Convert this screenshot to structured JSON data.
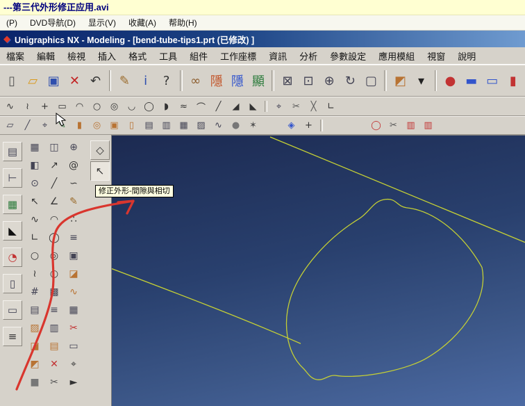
{
  "player": {
    "title": "---第三代外形修正应用.avi",
    "menus": [
      "(P)",
      "DVD导航(D)",
      "显示(V)",
      "收藏(A)",
      "帮助(H)"
    ]
  },
  "nx": {
    "title": "Unigraphics NX - Modeling - [bend-tube-tips1.prt (已修改) ]",
    "menus": [
      "檔案",
      "編輯",
      "檢視",
      "插入",
      "格式",
      "工具",
      "組件",
      "工作座標",
      "資訊",
      "分析",
      "參數設定",
      "應用模組",
      "視窗",
      "說明"
    ]
  },
  "tooltip": {
    "text": "修正外形-間隙與相切"
  },
  "colors": {
    "curve": "#c4cf35",
    "annotation": "#d9362e",
    "tooltip_bg": "#ffffe1",
    "viewport_top": "#1c2a51",
    "viewport_bottom": "#4c6aa3"
  },
  "toolbars": {
    "standard": [
      {
        "n": "new-file-icon",
        "g": "▯",
        "c": "#555"
      },
      {
        "n": "open-folder-icon",
        "g": "▱",
        "c": "#d99a1e"
      },
      {
        "n": "save-icon",
        "g": "▣",
        "c": "#2f4fae"
      },
      {
        "n": "delete-icon",
        "g": "✕",
        "c": "#c22222"
      },
      {
        "n": "undo-icon",
        "g": "↶",
        "c": "#333"
      },
      {
        "sep": true
      },
      {
        "n": "pen-icon",
        "g": "✎",
        "c": "#9a6a2a"
      },
      {
        "n": "info-icon",
        "g": "i",
        "c": "#2f4fae"
      },
      {
        "n": "help-icon",
        "g": "?",
        "c": "#333"
      },
      {
        "sep": true
      },
      {
        "n": "binoculars-icon",
        "g": "∞",
        "c": "#8a5a2a"
      },
      {
        "n": "hide-component-icon",
        "g": "隱",
        "c": "#c2552a"
      },
      {
        "n": "hide-others-icon",
        "g": "隱",
        "c": "#3355cc"
      },
      {
        "n": "show-component-icon",
        "g": "顯",
        "c": "#2a7a3a"
      },
      {
        "sep": true
      },
      {
        "n": "fit-view-icon",
        "g": "⊠",
        "c": "#445"
      },
      {
        "n": "zoom-box-icon",
        "g": "⊡",
        "c": "#445"
      },
      {
        "n": "zoom-in-icon",
        "g": "⊕",
        "c": "#445"
      },
      {
        "n": "refresh-view-icon",
        "g": "↻",
        "c": "#445"
      },
      {
        "n": "monitor-view-icon",
        "g": "▢",
        "c": "#445"
      },
      {
        "sep": true
      },
      {
        "n": "shaded-view-icon",
        "g": "◩",
        "c": "#b87333"
      },
      {
        "n": "dropdown-arrow-icon",
        "g": "▾",
        "c": "#222"
      },
      {
        "sep": true
      },
      {
        "n": "material-sphere-icon",
        "g": "●",
        "c": "#c23333"
      },
      {
        "n": "window-tile-icon",
        "g": "▬",
        "c": "#3355cc"
      },
      {
        "n": "window-cascade-icon",
        "g": "▭",
        "c": "#3355cc"
      },
      {
        "n": "edge-red-icon",
        "g": "▮",
        "c": "#c23333"
      }
    ],
    "curve": [
      {
        "n": "profile-icon",
        "g": "∿",
        "c": "#333"
      },
      {
        "n": "spline-icon",
        "g": "≀",
        "c": "#333"
      },
      {
        "n": "point-icon",
        "g": "+",
        "c": "#333"
      },
      {
        "n": "rectangle-icon",
        "g": "▭",
        "c": "#333"
      },
      {
        "n": "arc-icon",
        "g": "◠",
        "c": "#333"
      },
      {
        "n": "circle-icon",
        "g": "○",
        "c": "#333"
      },
      {
        "n": "circle-center-icon",
        "g": "◎",
        "c": "#333"
      },
      {
        "n": "arc-end-icon",
        "g": "◡",
        "c": "#333"
      },
      {
        "n": "ellipse-icon",
        "g": "◯",
        "c": "#333"
      },
      {
        "n": "conic-icon",
        "g": "◗",
        "c": "#333"
      },
      {
        "n": "offset-curve-icon",
        "g": "≈",
        "c": "#333"
      },
      {
        "n": "bridge-curve-icon",
        "g": "⌒",
        "c": "#333"
      },
      {
        "n": "line-icon",
        "g": "╱",
        "c": "#333"
      },
      {
        "n": "fillet-icon",
        "g": "◢",
        "c": "#333"
      },
      {
        "n": "chamfer-icon",
        "g": "◣",
        "c": "#333"
      },
      {
        "sep": true
      },
      {
        "n": "edit-curve-icon",
        "g": "⌖",
        "c": "#445"
      },
      {
        "n": "trim-curve-icon",
        "g": "✂",
        "c": "#555"
      },
      {
        "n": "divide-curve-icon",
        "g": "╳",
        "c": "#555"
      },
      {
        "n": "corner-icon",
        "g": "∟",
        "c": "#333"
      }
    ],
    "features": [
      {
        "n": "datum-plane-icon",
        "g": "▱",
        "c": "#445"
      },
      {
        "n": "datum-axis-icon",
        "g": "╱",
        "c": "#445"
      },
      {
        "n": "datum-csys-icon",
        "g": "⌖",
        "c": "#445"
      },
      {
        "n": "sketch-icon",
        "g": "✎",
        "c": "#2a6a3a"
      },
      {
        "n": "extrude-icon",
        "g": "▮",
        "c": "#b87333"
      },
      {
        "n": "revolve-icon",
        "g": "◎",
        "c": "#b87333"
      },
      {
        "n": "block-icon",
        "g": "▣",
        "c": "#b87333"
      },
      {
        "n": "cylinder-icon",
        "g": "▯",
        "c": "#b87333"
      },
      {
        "n": "sheet-one-icon",
        "g": "▤",
        "c": "#445"
      },
      {
        "n": "sheet-two-icon",
        "g": "▥",
        "c": "#445"
      },
      {
        "n": "sheet-grid-icon",
        "g": "▦",
        "c": "#445"
      },
      {
        "n": "ruled-surface-icon",
        "g": "▨",
        "c": "#445"
      },
      {
        "n": "swept-surface-icon",
        "g": "∿",
        "c": "#445"
      },
      {
        "n": "sphere-icon",
        "g": "●",
        "c": "#777"
      },
      {
        "n": "swirl-icon",
        "g": "✶",
        "c": "#555"
      },
      {
        "gap": 30
      },
      {
        "n": "window-grid-icon",
        "g": "◈",
        "c": "#3355cc"
      },
      {
        "n": "add-tool-icon",
        "g": "+",
        "c": "#333"
      },
      {
        "sep": true
      },
      {
        "gap": 60
      },
      {
        "n": "ring-icon",
        "g": "◯",
        "c": "#c23333"
      },
      {
        "n": "trim-body-icon",
        "g": "✂",
        "c": "#555"
      },
      {
        "n": "red-plate-icon",
        "g": "▥",
        "c": "#c23333"
      },
      {
        "n": "red-plate-two-icon",
        "g": "▥",
        "c": "#c23333"
      }
    ]
  },
  "left_panels": {
    "edge": [
      {
        "n": "navigator-icon",
        "g": "▤",
        "c": "#445"
      },
      {
        "n": "history-tree-icon",
        "g": "⊢",
        "c": "#445"
      },
      {
        "n": "palette-icon",
        "g": "▦",
        "c": "#2a7a3a"
      },
      {
        "n": "tutorials-icon",
        "g": "◣",
        "c": "#111"
      },
      {
        "n": "clock-icon",
        "g": "◔",
        "c": "#c23333"
      },
      {
        "n": "notes-icon",
        "g": "▯",
        "c": "#445"
      },
      {
        "n": "dialog-pane-icon",
        "g": "▭",
        "c": "#445"
      },
      {
        "n": "list-pane-icon",
        "g": "≡",
        "c": "#333"
      }
    ],
    "col1": [
      {
        "n": "spreadsheet-icon",
        "g": "▦",
        "c": "#445"
      },
      {
        "n": "view-cube-icon",
        "g": "◧",
        "c": "#445"
      },
      {
        "n": "magnifier-icon",
        "g": "⊙",
        "c": "#445"
      },
      {
        "n": "arrow-tool-icon",
        "g": "↖",
        "c": "#333"
      },
      {
        "n": "curve-tool-icon",
        "g": "∿",
        "c": "#333"
      },
      {
        "n": "corner-tool-icon",
        "g": "∟",
        "c": "#333"
      },
      {
        "n": "circle-tool-icon",
        "g": "○",
        "c": "#333"
      },
      {
        "n": "spline-tool-icon",
        "g": "≀",
        "c": "#333"
      },
      {
        "n": "grid-icon",
        "g": "#",
        "c": "#445"
      },
      {
        "n": "sheet-small-icon",
        "g": "▤",
        "c": "#445"
      },
      {
        "n": "surface-icon",
        "g": "▨",
        "c": "#b87333"
      },
      {
        "n": "face-icon",
        "g": "◪",
        "c": "#b87333"
      },
      {
        "n": "shade-icon",
        "g": "◩",
        "c": "#b87333"
      },
      {
        "n": "solid-icon",
        "g": "■",
        "c": "#777"
      }
    ],
    "col2": [
      {
        "n": "cube-edges-icon",
        "g": "◫",
        "c": "#445"
      },
      {
        "n": "arrow-ne-icon",
        "g": "↗",
        "c": "#333"
      },
      {
        "n": "line-tool-icon",
        "g": "╱",
        "c": "#333"
      },
      {
        "n": "polyline-icon",
        "g": "∠",
        "c": "#333"
      },
      {
        "n": "arc-tool-icon",
        "g": "◠",
        "c": "#333"
      },
      {
        "n": "ellipse-tool-icon",
        "g": "◯",
        "c": "#333"
      },
      {
        "n": "circle-two-icon",
        "g": "◎",
        "c": "#333"
      },
      {
        "n": "oval-icon",
        "g": "○",
        "c": "#333"
      },
      {
        "n": "grid-two-icon",
        "g": "▩",
        "c": "#445"
      },
      {
        "n": "list-icon",
        "g": "≡",
        "c": "#445"
      },
      {
        "n": "pages-icon",
        "g": "▥",
        "c": "#445"
      },
      {
        "n": "stack-icon",
        "g": "▤",
        "c": "#b87333"
      },
      {
        "n": "delete-small-icon",
        "g": "✕",
        "c": "#c23333"
      },
      {
        "n": "scissors-icon",
        "g": "✂",
        "c": "#555"
      }
    ],
    "col3": [
      {
        "n": "zoom-tool-icon",
        "g": "⊕",
        "c": "#445"
      },
      {
        "n": "spiral-icon",
        "g": "@",
        "c": "#333"
      },
      {
        "n": "freehand-icon",
        "g": "∽",
        "c": "#333"
      },
      {
        "n": "pencil-icon",
        "g": "✎",
        "c": "#9a6a2a"
      },
      {
        "n": "points-icon",
        "g": "∴",
        "c": "#333"
      },
      {
        "n": "numbered-list-icon",
        "g": "≡",
        "c": "#445"
      },
      {
        "n": "boxes-icon",
        "g": "▣",
        "c": "#445"
      },
      {
        "n": "patch-icon",
        "g": "◪",
        "c": "#b87333"
      },
      {
        "n": "sweep-icon",
        "g": "∿",
        "c": "#b87333"
      },
      {
        "n": "mesh-icon",
        "g": "▦",
        "c": "#445"
      },
      {
        "n": "trim-small-icon",
        "g": "✂",
        "c": "#c23333"
      },
      {
        "n": "card-icon",
        "g": "▭",
        "c": "#445"
      },
      {
        "n": "target-icon",
        "g": "⌖",
        "c": "#333"
      },
      {
        "n": "flag-icon",
        "g": "►",
        "c": "#333"
      }
    ],
    "floating": [
      {
        "n": "snip-tool-icon",
        "g": "◇",
        "c": "#333"
      },
      {
        "n": "repair-shape-tool-icon",
        "g": "↖",
        "c": "#333",
        "hov": true
      }
    ]
  }
}
